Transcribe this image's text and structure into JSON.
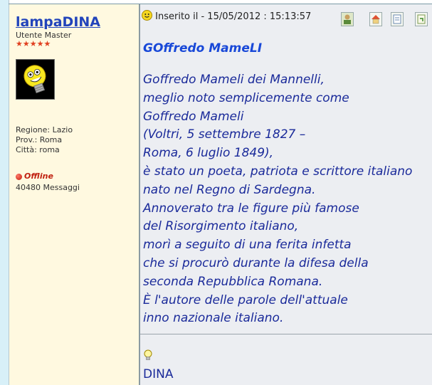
{
  "user": {
    "username": "lampaDINA",
    "rank": "Utente Master",
    "stars": "★★★★★",
    "region": "Regione: Lazio",
    "province": "Prov.: Roma",
    "city": "Città: roma",
    "status": "Offline",
    "message_count": "40480 Messaggi"
  },
  "post": {
    "posted_at": "Inserito il - 15/05/2012 : 15:13:57",
    "title": "GOffredo MameLI",
    "lines": [
      "Goffredo Mameli dei Mannelli,",
      "meglio noto semplicemente come",
      "Goffredo Mameli",
      "(Voltri, 5 settembre 1827 –",
      "Roma, 6 luglio 1849),",
      "è stato un poeta, patriota e scrittore italiano",
      "nato nel Regno di Sardegna.",
      "Annoverato tra le figure più famose",
      "del Risorgimento italiano,",
      "morì a seguito di una ferita infetta",
      "che si procurò durante la difesa della",
      "seconda Repubblica Romana.",
      "È l'autore delle parole dell'attuale",
      "inno nazionale italiano."
    ],
    "signature": "DINA"
  },
  "icons": {
    "posted": "smiley-icon",
    "profile": "user-profile-icon",
    "home": "home-icon",
    "edit": "edit-icon",
    "quote": "quote-icon",
    "signature": "lightbulb-icon"
  },
  "colors": {
    "username": "#2244bb",
    "post_text": "#1a2a9a",
    "offline": "#c02010",
    "post_bg": "#eceef2",
    "user_bg": "#fff9e0"
  }
}
